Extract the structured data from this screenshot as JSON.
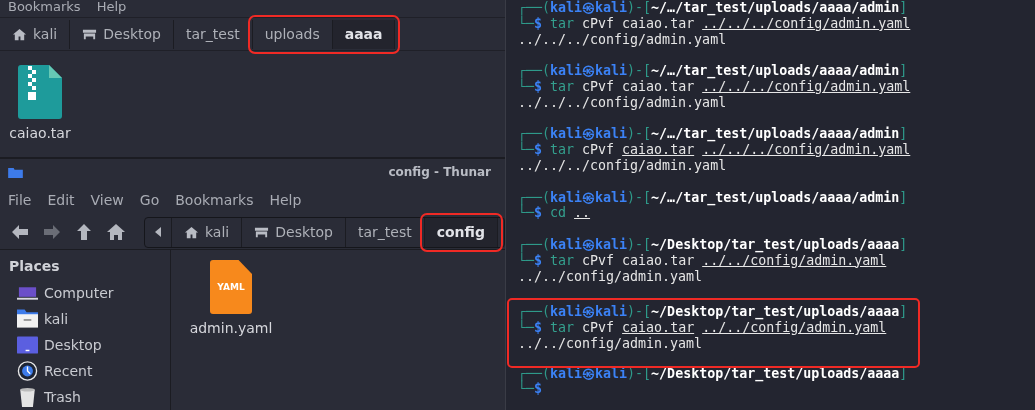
{
  "top_window": {
    "menu": [
      "Bookmarks",
      "Help"
    ],
    "path_bar": [
      {
        "label": "kali",
        "kind": "home",
        "selected": false,
        "highlighted": false
      },
      {
        "label": "Desktop",
        "kind": "desktop",
        "selected": false,
        "highlighted": false
      },
      {
        "label": "tar_test",
        "kind": "folder",
        "selected": false,
        "highlighted": false
      },
      {
        "label": "uploads",
        "kind": "folder",
        "selected": false,
        "highlighted": true
      },
      {
        "label": "aaaa",
        "kind": "folder",
        "selected": true,
        "highlighted": true
      }
    ],
    "files": [
      {
        "name": "caiao.tar",
        "kind": "archive"
      }
    ]
  },
  "bottom_window": {
    "title": "config - Thunar",
    "menu": [
      "File",
      "Edit",
      "View",
      "Go",
      "Bookmarks",
      "Help"
    ],
    "path_bar": [
      {
        "label": "kali",
        "kind": "home",
        "selected": false,
        "highlighted": false
      },
      {
        "label": "Desktop",
        "kind": "desktop",
        "selected": false,
        "highlighted": false
      },
      {
        "label": "tar_test",
        "kind": "folder",
        "selected": false,
        "highlighted": false
      },
      {
        "label": "config",
        "kind": "folder",
        "selected": true,
        "highlighted": true
      }
    ],
    "sidebar": {
      "heading": "Places",
      "items": [
        {
          "label": "Computer",
          "kind": "computer"
        },
        {
          "label": "kali",
          "kind": "home"
        },
        {
          "label": "Desktop",
          "kind": "desktop"
        },
        {
          "label": "Recent",
          "kind": "recent"
        },
        {
          "label": "Trash",
          "kind": "trash"
        }
      ]
    },
    "files": [
      {
        "name": "admin.yaml",
        "kind": "yaml",
        "icon_label": "YAML"
      }
    ]
  },
  "terminal": {
    "blocks": [
      {
        "prompt": {
          "open": "┌──(",
          "user": "kali㉿kali",
          "mid": ")-[",
          "path": "~/…/tar_test/uploads/aaaa/admin",
          "close": "]"
        },
        "command": {
          "corner": "└─",
          "sign": "$",
          "tokens": [
            {
              "text": "tar",
              "kind": "cmd"
            },
            {
              "text": "cPvf",
              "kind": "arg"
            },
            {
              "text": "caiao.tar",
              "kind": "arg"
            },
            {
              "text": "../../../config/admin.yaml",
              "kind": "path"
            }
          ]
        },
        "output": "../../../config/admin.yaml",
        "highlighted": false
      },
      {
        "prompt": {
          "open": "┌──(",
          "user": "kali㉿kali",
          "mid": ")-[",
          "path": "~/…/tar_test/uploads/aaaa/admin",
          "close": "]"
        },
        "command": {
          "corner": "└─",
          "sign": "$",
          "tokens": [
            {
              "text": "tar",
              "kind": "cmd"
            },
            {
              "text": "cPvf",
              "kind": "arg"
            },
            {
              "text": "caiao.tar",
              "kind": "arg"
            },
            {
              "text": "../../../config/admin.yaml",
              "kind": "path"
            }
          ]
        },
        "output": "../../../config/admin.yaml",
        "highlighted": false
      },
      {
        "prompt": {
          "open": "┌──(",
          "user": "kali㉿kali",
          "mid": ")-[",
          "path": "~/…/tar_test/uploads/aaaa/admin",
          "close": "]"
        },
        "command": {
          "corner": "└─",
          "sign": "$",
          "tokens": [
            {
              "text": "tar",
              "kind": "cmd"
            },
            {
              "text": "cPvf",
              "kind": "arg"
            },
            {
              "text": "caiao.tar",
              "kind": "path"
            },
            {
              "text": "../../../config/admin.yaml",
              "kind": "path"
            }
          ]
        },
        "output": "../../../config/admin.yaml",
        "highlighted": false
      },
      {
        "prompt": {
          "open": "┌──(",
          "user": "kali㉿kali",
          "mid": ")-[",
          "path": "~/…/tar_test/uploads/aaaa/admin",
          "close": "]"
        },
        "command": {
          "corner": "└─",
          "sign": "$",
          "tokens": [
            {
              "text": "cd",
              "kind": "cmd"
            },
            {
              "text": "..",
              "kind": "path"
            }
          ]
        },
        "highlighted": false
      },
      {
        "prompt": {
          "open": "┌──(",
          "user": "kali㉿kali",
          "mid": ")-[",
          "path": "~/Desktop/tar_test/uploads/aaaa",
          "close": "]"
        },
        "command": {
          "corner": "└─",
          "sign": "$",
          "tokens": [
            {
              "text": "tar",
              "kind": "cmd"
            },
            {
              "text": "cPvf",
              "kind": "arg"
            },
            {
              "text": "caiao.tar",
              "kind": "arg"
            },
            {
              "text": "../../config/admin.yaml",
              "kind": "path"
            }
          ]
        },
        "output": "../../config/admin.yaml",
        "highlighted": false
      },
      {
        "prompt": {
          "open": "┌──(",
          "user": "kali㉿kali",
          "mid": ")-[",
          "path": "~/Desktop/tar_test/uploads/aaaa",
          "close": "]"
        },
        "command": {
          "corner": "└─",
          "sign": "$",
          "tokens": [
            {
              "text": "tar",
              "kind": "cmd"
            },
            {
              "text": "cPvf",
              "kind": "arg"
            },
            {
              "text": "caiao.tar",
              "kind": "path"
            },
            {
              "text": "../../config/admin.yaml",
              "kind": "path"
            }
          ]
        },
        "output": "../../config/admin.yaml",
        "highlighted": true
      },
      {
        "prompt": {
          "open": "┌──(",
          "user": "kali㉿kali",
          "mid": ")-[",
          "path": "~/Desktop/tar_test/uploads/aaaa",
          "close": "]"
        },
        "command": {
          "corner": "└─",
          "sign": "$"
        },
        "highlighted": false
      }
    ]
  }
}
